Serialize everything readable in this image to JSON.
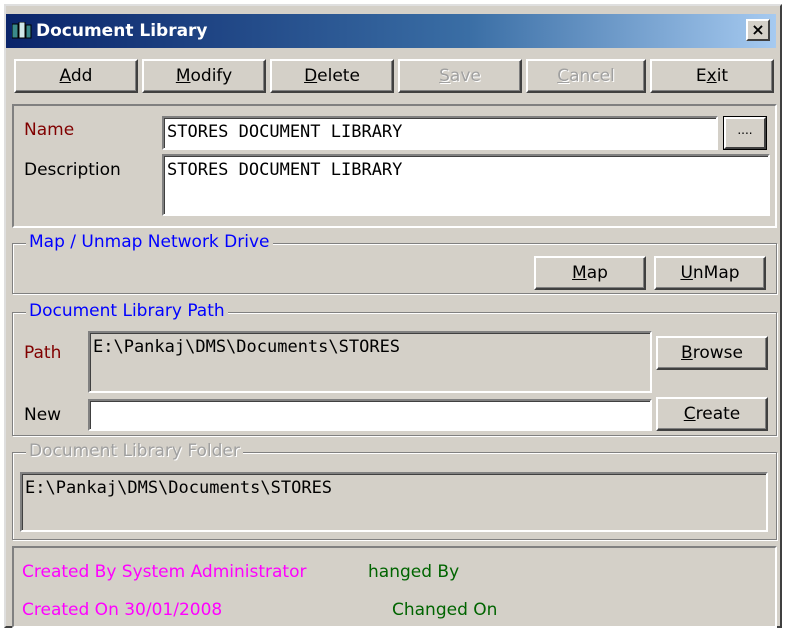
{
  "window": {
    "title": "Document Library",
    "close_glyph": "×",
    "icon": "library-icon"
  },
  "toolbar": {
    "add": {
      "pre": "",
      "u": "A",
      "post": "dd"
    },
    "modify": {
      "pre": "",
      "u": "M",
      "post": "odify"
    },
    "delete": {
      "pre": "",
      "u": "D",
      "post": "elete"
    },
    "save": {
      "pre": "",
      "u": "S",
      "post": "ave"
    },
    "cancel": {
      "pre": "",
      "u": "C",
      "post": "ancel"
    },
    "exit": {
      "pre": "E",
      "u": "x",
      "post": "it"
    }
  },
  "details": {
    "name_label": "Name",
    "name_value": "STORES DOCUMENT LIBRARY",
    "lookup_button": "....",
    "description_label": "Description",
    "description_value": "STORES DOCUMENT LIBRARY"
  },
  "network": {
    "title": "Map / Unmap  Network Drive",
    "map": {
      "pre": "",
      "u": "M",
      "post": "ap"
    },
    "unmap": {
      "pre": "",
      "u": "U",
      "post": "nMap"
    }
  },
  "path_group": {
    "title": "Document Library Path",
    "path_label": "Path",
    "path_value": "E:\\Pankaj\\DMS\\Documents\\STORES",
    "browse": {
      "pre": "",
      "u": "B",
      "post": "rowse"
    },
    "new_label": "New",
    "new_value": "",
    "create": {
      "pre": "",
      "u": "C",
      "post": "reate"
    }
  },
  "folder_group": {
    "title": "Document Library Folder",
    "folder_value": "E:\\Pankaj\\DMS\\Documents\\STORES"
  },
  "audit": {
    "created_by": "Created By System Administrator",
    "changed_by": "hanged By",
    "created_on": "Created On 30/01/2008",
    "changed_on": "Changed On"
  },
  "colors": {
    "title_gradient_start": "#0a246a",
    "name_label": "#800000",
    "group_title": "#0000ff",
    "disabled_text": "#a0a0a0",
    "created_text": "#ff00ff",
    "changed_text": "#006400"
  }
}
